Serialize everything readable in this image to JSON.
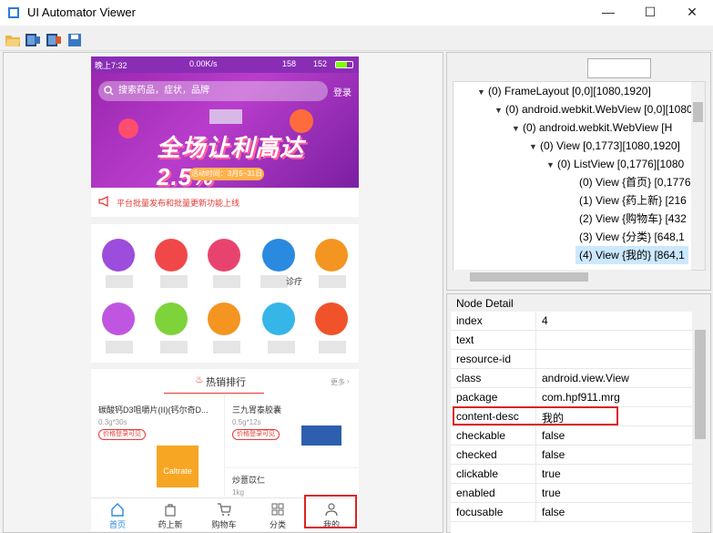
{
  "window": {
    "title": "UI Automator Viewer",
    "minimize": "—",
    "maximize": "☐",
    "close": "✕"
  },
  "toolbar": {
    "icons": [
      "open-folder-icon",
      "device-screenshot-icon",
      "device-screenshot-compressed-icon",
      "save-icon"
    ]
  },
  "phone": {
    "status": {
      "time": "晚上7:32",
      "speed": "0.00K/s",
      "signal": "158",
      "battery": "152"
    },
    "search_placeholder": "搜索药品，症状，品牌",
    "login": "登录",
    "banner_text": "全场让利高达2.5%",
    "banner_sub": "活动时间：3月5~31日",
    "notice": "平台批量发布和批量更新功能上线",
    "grid_partial_label": "诊疗",
    "hot_label": "热销排行",
    "more": "更多",
    "products": [
      {
        "name": "碳酸钙D3咀嚼片(II)(钙尔奇D...",
        "spec": "0.3g*30s",
        "price_tag": "价格登录可见",
        "brand": "Caltrate"
      },
      {
        "name": "三九胃泰胶囊",
        "spec": "0.5g*12s",
        "price_tag": "价格登录可见"
      },
      {
        "name": "炒薏苡仁",
        "spec": "1kg"
      }
    ],
    "nav": [
      "首页",
      "药上新",
      "购物车",
      "分类",
      "我的"
    ]
  },
  "tree": {
    "rows": [
      {
        "text": "(0) FrameLayout [0,0][1080,1920]",
        "toggle": "▼"
      },
      {
        "text": "(0) android.webkit.WebView [0,0][1080,1920]",
        "toggle": "▼"
      },
      {
        "text": "(0) android.webkit.WebView [H",
        "toggle": "▼"
      },
      {
        "text": "(0) View [0,1773][1080,1920]",
        "toggle": "▼"
      },
      {
        "text": "(0) ListView [0,1776][1080",
        "toggle": "▼"
      },
      {
        "text": "(0) View {首页} [0,1776",
        "toggle": ""
      },
      {
        "text": "(1) View {药上新} [216",
        "toggle": ""
      },
      {
        "text": "(2) View {购物车} [432",
        "toggle": ""
      },
      {
        "text": "(3) View {分类} [648,1",
        "toggle": ""
      },
      {
        "text": "(4) View {我的} [864,1",
        "toggle": ""
      }
    ]
  },
  "detail": {
    "title": "Node Detail",
    "rows": [
      {
        "key": "index",
        "value": "4"
      },
      {
        "key": "text",
        "value": ""
      },
      {
        "key": "resource-id",
        "value": ""
      },
      {
        "key": "class",
        "value": "android.view.View"
      },
      {
        "key": "package",
        "value": "com.hpf911.mrg"
      },
      {
        "key": "content-desc",
        "value": "我的"
      },
      {
        "key": "checkable",
        "value": "false"
      },
      {
        "key": "checked",
        "value": "false"
      },
      {
        "key": "clickable",
        "value": "true"
      },
      {
        "key": "enabled",
        "value": "true"
      },
      {
        "key": "focusable",
        "value": "false"
      }
    ]
  },
  "colors": {
    "accent": "#d22222",
    "banner": "#9b27b0",
    "selection": "#cce8ff"
  }
}
